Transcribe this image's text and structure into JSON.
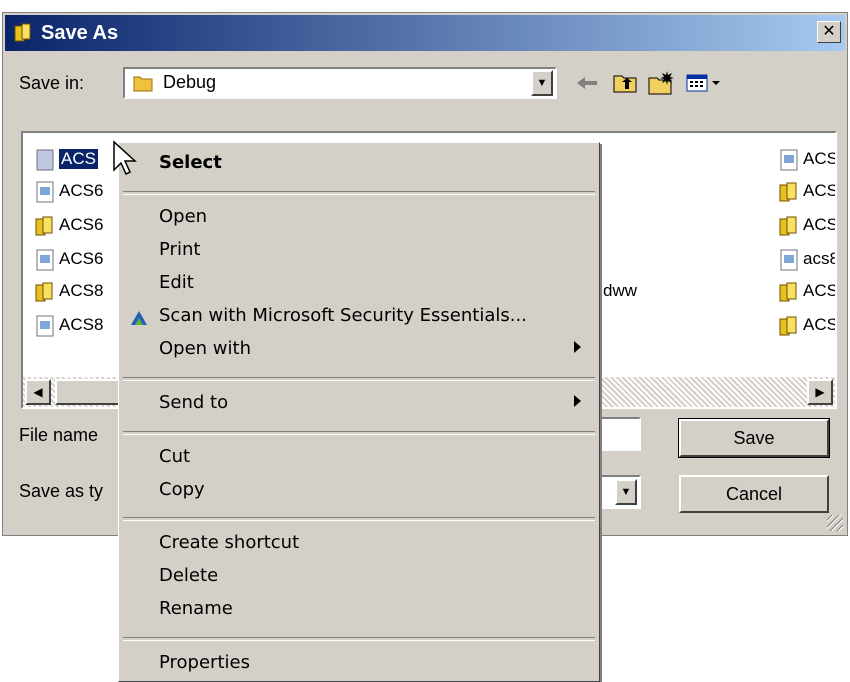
{
  "window": {
    "title": "Save As",
    "close_label": "✕"
  },
  "toolbar": {
    "save_in_label": "Save in:",
    "save_in_value": "Debug",
    "icons": [
      "back-arrow-icon",
      "up-folder-icon",
      "new-folder-icon",
      "view-menu-icon"
    ]
  },
  "files": {
    "col1": [
      {
        "name": "ACS",
        "icon": "document-icon",
        "selected": true
      },
      {
        "name": "ACS6",
        "icon": "document-icon"
      },
      {
        "name": "ACS6",
        "icon": "exe-icon"
      },
      {
        "name": "ACS6",
        "icon": "document-icon"
      },
      {
        "name": "ACS8",
        "icon": "exe-icon"
      },
      {
        "name": "ACS8",
        "icon": "document-icon"
      }
    ],
    "col2_partial": "dww",
    "col3": [
      {
        "name": "ACS",
        "icon": "document-icon"
      },
      {
        "name": "ACS",
        "icon": "exe-icon"
      },
      {
        "name": "ACS",
        "icon": "exe-icon"
      },
      {
        "name": "acs8",
        "icon": "document-icon"
      },
      {
        "name": "ACS",
        "icon": "exe-icon"
      },
      {
        "name": "ACS",
        "icon": "exe-icon"
      }
    ]
  },
  "fields": {
    "file_name_label": "File name",
    "save_as_type_label": "Save as ty"
  },
  "buttons": {
    "save": "Save",
    "cancel": "Cancel"
  },
  "context_menu": {
    "select": "Select",
    "open": "Open",
    "print": "Print",
    "edit": "Edit",
    "scan": "Scan with Microsoft Security Essentials...",
    "open_with": "Open with",
    "send_to": "Send to",
    "cut": "Cut",
    "copy": "Copy",
    "create_shortcut": "Create shortcut",
    "delete": "Delete",
    "rename": "Rename",
    "properties": "Properties"
  },
  "colors": {
    "title_start": "#0a246a",
    "title_end": "#a6caf0",
    "face": "#d4d0c8",
    "selection": "#0a246a"
  }
}
